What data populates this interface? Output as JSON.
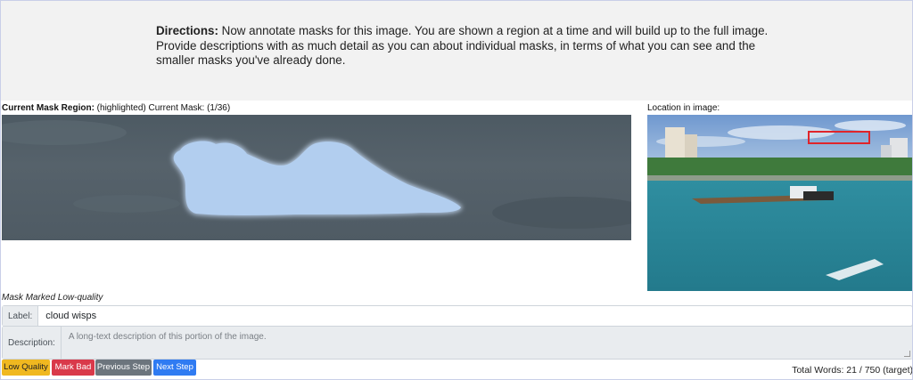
{
  "directions": {
    "title": "Directions:",
    "text": " Now annotate masks for this image. You are shown a region at a time and will build up to the full image. Provide descriptions with as much detail as you can about individual masks, in terms of what you can see and the smaller masks you've already done."
  },
  "region": {
    "title": "Current Mask Region:",
    "subtitle": " (highlighted) Current Mask: (1/36)"
  },
  "location": {
    "title": "Location in image:"
  },
  "quality_note": "Mask Marked Low-quality",
  "form": {
    "label_addon": "Label:",
    "label_value": "cloud wisps",
    "description_addon": "Description:",
    "description_placeholder": "A long-text description of this portion of the image."
  },
  "buttons": {
    "low_quality": "Low Quality",
    "mark_bad": "Mark Bad",
    "previous": "Previous Step",
    "next": "Next Step"
  },
  "total_words": "Total Words: 21 / 750 (target)",
  "colors": {
    "warning": "#f0b820",
    "danger": "#d9394a",
    "secondary": "#6c757d",
    "primary": "#2f7bf2",
    "mask_highlight": "#a9c8ee",
    "location_box": "#e0242a"
  }
}
